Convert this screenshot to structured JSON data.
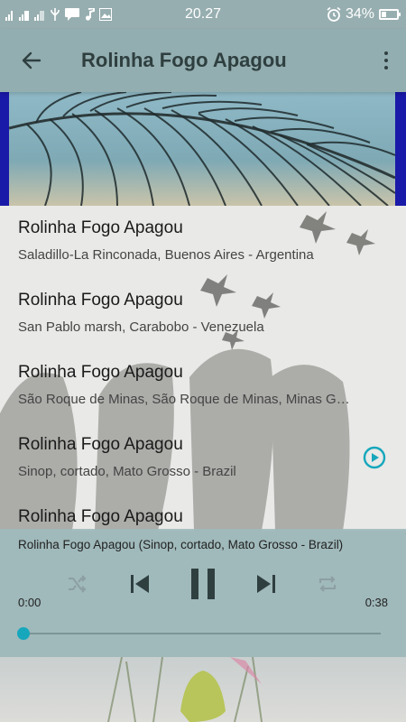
{
  "status_bar": {
    "time": "20.27",
    "battery_percent": "34%",
    "battery_level": 0.34,
    "icons": [
      "signal-icon",
      "signal-icon",
      "signal-icon",
      "usb-icon",
      "message-icon",
      "music-icon",
      "image-icon",
      "alarm-icon",
      "battery-icon"
    ]
  },
  "toolbar": {
    "title": "Rolinha Fogo Apagou",
    "back_icon": "arrow-left-icon",
    "menu_icon": "more-vert-icon"
  },
  "tracks": [
    {
      "title": "Rolinha Fogo Apagou",
      "subtitle": "Saladillo-La Rinconada, Buenos Aires - Argentina"
    },
    {
      "title": "Rolinha Fogo Apagou",
      "subtitle": "San Pablo marsh, Carabobo - Venezuela"
    },
    {
      "title": "Rolinha Fogo Apagou",
      "subtitle": "São Roque de Minas, São Roque de Minas, Minas Gerais - Brazil"
    },
    {
      "title": "Rolinha Fogo Apagou",
      "subtitle": "Sinop, cortado, Mato Grosso - Brazil"
    },
    {
      "title": "Rolinha Fogo Apagou",
      "subtitle": ""
    }
  ],
  "player": {
    "now_playing": "Rolinha Fogo Apagou (Sinop, cortado, Mato Grosso - Brazil)",
    "current_time": "0:00",
    "total_time": "0:38",
    "progress": 0.0,
    "accent_color": "#16a7bc"
  }
}
